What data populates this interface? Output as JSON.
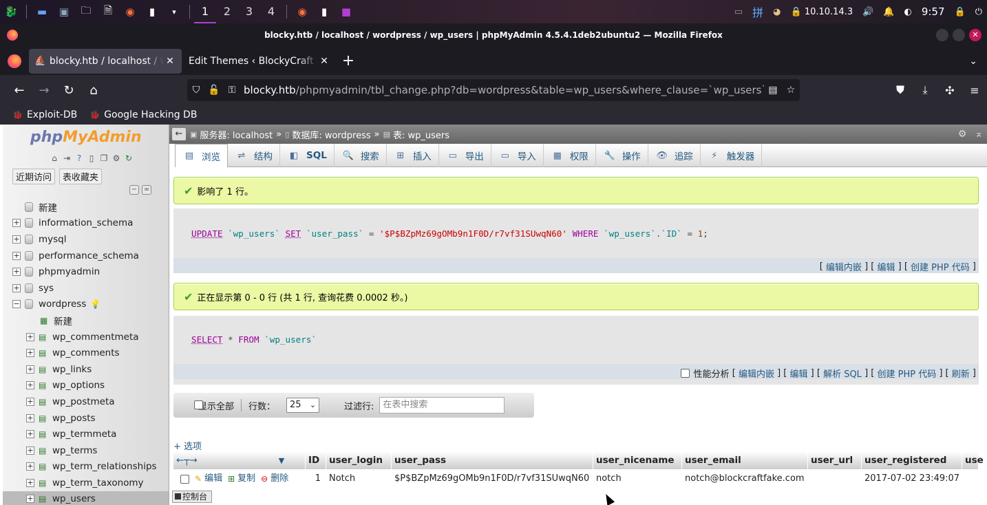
{
  "taskbar": {
    "workspaces": [
      "1",
      "2",
      "3",
      "4"
    ],
    "active_workspace": 0,
    "ip": "10.10.14.3",
    "clock": "9:57",
    "ime": "拼"
  },
  "window": {
    "title": "blocky.htb / localhost / wordpress / wp_users | phpMyAdmin 4.5.4.1deb2ubuntu2 — Mozilla Firefox"
  },
  "tabs": [
    {
      "label": "blocky.htb / localhost / wordpress / wp_users | phpMyAdmin",
      "active": true
    },
    {
      "label": "Edit Themes ‹ BlockyCraft — WordPress",
      "active": false
    }
  ],
  "urlbar": {
    "host": "blocky.htb",
    "path": "/phpmyadmin/tbl_change.php?db=wordpress&table=wp_users&where_clause=`wp_users`.`ID`+"
  },
  "bookmarks": [
    "Exploit-DB",
    "Google Hacking DB"
  ],
  "navpanel": {
    "logo_php": "php",
    "logo_myadmin": "MyAdmin",
    "recent_label": "近期访问",
    "favorites_label": "表收藏夹",
    "new_label": "新建",
    "databases": [
      "information_schema",
      "mysql",
      "performance_schema",
      "phpmyadmin",
      "sys",
      "wordpress"
    ],
    "wordpress_new": "新建",
    "tables": [
      "wp_commentmeta",
      "wp_comments",
      "wp_links",
      "wp_options",
      "wp_postmeta",
      "wp_posts",
      "wp_termmeta",
      "wp_terms",
      "wp_term_relationships",
      "wp_term_taxonomy",
      "wp_users"
    ]
  },
  "breadcrumb": {
    "server": "服务器: localhost",
    "database": "数据库: wordpress",
    "table": "表: wp_users"
  },
  "topmenu": [
    {
      "label": "浏览",
      "icon": "browse-icon"
    },
    {
      "label": "结构",
      "icon": "structure-icon"
    },
    {
      "label": "SQL",
      "icon": "sql-icon"
    },
    {
      "label": "搜索",
      "icon": "search-icon"
    },
    {
      "label": "插入",
      "icon": "insert-icon"
    },
    {
      "label": "导出",
      "icon": "export-icon"
    },
    {
      "label": "导入",
      "icon": "import-icon"
    },
    {
      "label": "权限",
      "icon": "privileges-icon"
    },
    {
      "label": "操作",
      "icon": "operations-icon"
    },
    {
      "label": "追踪",
      "icon": "tracking-icon"
    },
    {
      "label": "触发器",
      "icon": "triggers-icon"
    }
  ],
  "messages": {
    "affected": "影响了 1 行。",
    "showing": "正在显示第 0 - 0 行 (共 1 行, 查询花费 0.0002 秒。)"
  },
  "query1": {
    "links": {
      "edit_inline": "编辑内嵌",
      "edit": "编辑",
      "create_php": "创建 PHP 代码"
    }
  },
  "query2": {
    "profiling": "性能分析",
    "links": {
      "edit_inline": "编辑内嵌",
      "edit": "编辑",
      "explain": "解析 SQL",
      "create_php": "创建 PHP 代码",
      "refresh": "刷新"
    }
  },
  "filter": {
    "show_all": "显示全部",
    "rows_label": "行数：",
    "rows_value": "25",
    "filter_label": "过滤行:",
    "filter_placeholder": "在表中搜索"
  },
  "options_link": "+ 选项",
  "columns": [
    "ID",
    "user_login",
    "user_pass",
    "user_nicename",
    "user_email",
    "user_url",
    "user_registered",
    "use"
  ],
  "row": {
    "edit": "编辑",
    "copy": "复制",
    "delete": "删除",
    "id": "1",
    "user_login": "Notch",
    "user_pass": "$P$BZpMz69gOMb9n1F0D/r7vf31SUwqN60",
    "user_nicename": "notch",
    "user_email": "notch@blockcraftfake.com",
    "user_url": "",
    "user_registered": "2017-07-02 23:49:07"
  },
  "console": "控制台"
}
